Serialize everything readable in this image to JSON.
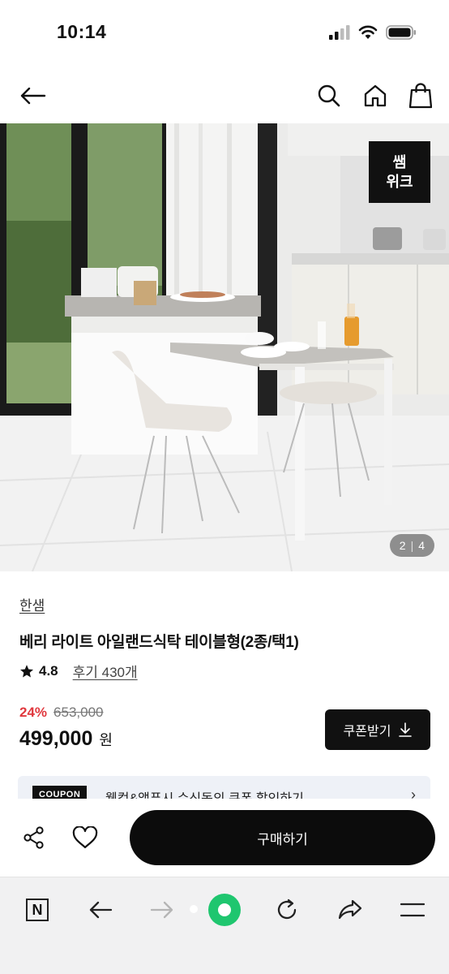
{
  "status": {
    "time": "10:14"
  },
  "hero": {
    "badge_line1": "쌤",
    "badge_line2": "위크",
    "counter_current": "2",
    "counter_sep": "|",
    "counter_total": "4"
  },
  "product": {
    "brand": "한샘",
    "title": "베리 라이트 아일랜드식탁 테이블형(2종/택1)",
    "rating": "4.8",
    "review_label": "후기 430개",
    "discount": "24%",
    "original_price": "653,000",
    "price": "499,000",
    "currency": "원"
  },
  "coupon_button": {
    "label": "쿠폰받기"
  },
  "banner": {
    "tag": "COUPON",
    "text": "웰컴&앱푸시 수신동의 쿠폰 할인하기"
  },
  "actions": {
    "buy_label": "구매하기"
  },
  "icons": {
    "back": "back-arrow-icon",
    "search": "search-icon",
    "home": "home-icon",
    "bag": "shopping-bag-icon",
    "star": "star-icon",
    "download": "download-icon",
    "share": "share-icon",
    "heart": "heart-icon",
    "chevron": "chevron-right-icon"
  },
  "browser": {
    "n_label": "N"
  }
}
